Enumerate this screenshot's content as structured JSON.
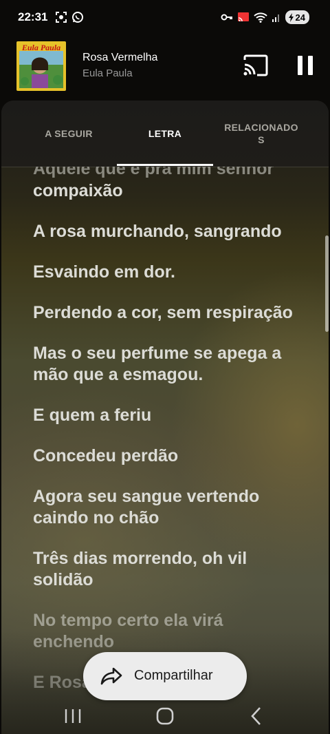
{
  "status_bar": {
    "time": "22:31",
    "battery_level": "24",
    "left_icons": [
      "screenshot-icon",
      "whatsapp-icon"
    ],
    "right_icons": [
      "vpn-key-icon",
      "cast-icon",
      "wifi-icon",
      "signal-icon",
      "battery-icon"
    ]
  },
  "player": {
    "cover_text": "Eula Paula",
    "title": "Rosa Vermelha",
    "artist": "Eula Paula",
    "is_playing": true
  },
  "tabs": [
    {
      "label": "A SEGUIR",
      "active": false
    },
    {
      "label": "LETRA",
      "active": true
    },
    {
      "label": "RELACIONADO\nS",
      "active": false
    }
  ],
  "lyrics": {
    "partial_top": "Aquele que é pra mim senhor",
    "lines": [
      "compaixão",
      "A rosa murchando, sangrando",
      "Esvaindo em dor.",
      "Perdendo a cor, sem respiração",
      "Mas o seu perfume se apega a mão que a esmagou.",
      "E quem a feriu",
      "Concedeu perdão",
      "Agora seu sangue vertendo caindo no chão",
      "Três dias morrendo, oh vil solidão",
      "No tempo certo ela virá enchendo",
      "E Rosa Vermelha de novo"
    ]
  },
  "share_button": {
    "label": "Compartilhar"
  },
  "colors": {
    "accent": "#ffffff",
    "inactive_tab": "#a9a7a0",
    "share_bg": "#ececec"
  }
}
